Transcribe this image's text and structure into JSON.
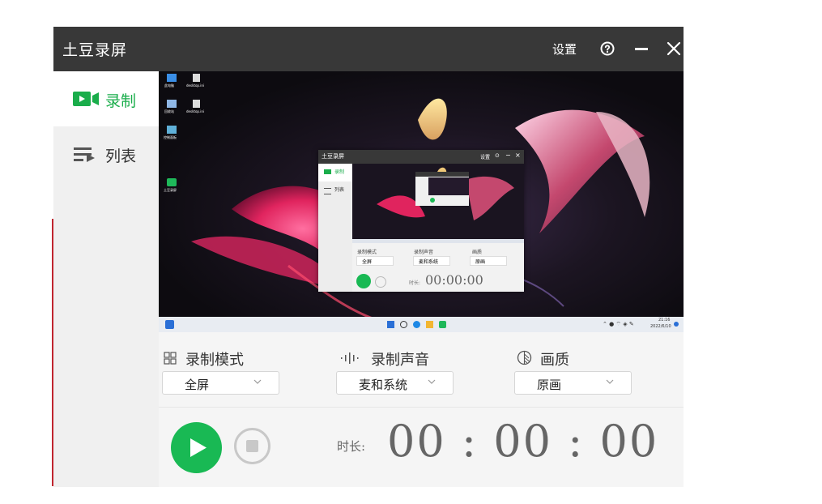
{
  "app": {
    "title": "土豆录屏"
  },
  "titlebar": {
    "settings_label": "设置"
  },
  "sidebar": {
    "items": [
      {
        "label": "录制",
        "active": true,
        "icon": "video-record-icon"
      },
      {
        "label": "列表",
        "active": false,
        "icon": "list-play-icon"
      }
    ]
  },
  "preview": {
    "desktop_icons": [
      {
        "label": "此电脑",
        "icon": "computer-icon"
      },
      {
        "label": "desktop.ini",
        "icon": "file-icon"
      },
      {
        "label": "回收站",
        "icon": "recycle-bin-icon"
      },
      {
        "label": "desktop.ini",
        "icon": "file-icon"
      },
      {
        "label": "控制面板",
        "icon": "control-panel-icon"
      },
      {
        "label": "土豆录屏",
        "icon": "app-icon"
      }
    ],
    "mini_window": {
      "title": "土豆录屏",
      "settings_label": "设置",
      "nav": [
        "录制",
        "列表"
      ],
      "labels": [
        "录制模式",
        "录制声音",
        "画质"
      ],
      "values": [
        "全屏",
        "麦和系统",
        "原画"
      ],
      "duration_label": "时长:",
      "timer": "00:00:00"
    },
    "taskbar": {
      "time": "21:16",
      "date": "2022/6/10"
    }
  },
  "controls": {
    "mode": {
      "label": "录制模式",
      "value": "全屏",
      "icon": "grid-icon"
    },
    "audio": {
      "label": "录制声音",
      "value": "麦和系统",
      "icon": "sound-wave-icon"
    },
    "quality": {
      "label": "画质",
      "value": "原画",
      "icon": "quality-icon"
    },
    "duration_label": "时长:",
    "timer": "00 : 00 : 00"
  },
  "colors": {
    "accent": "#1aad4b",
    "titlebar": "#383838",
    "play": "#19b954"
  }
}
